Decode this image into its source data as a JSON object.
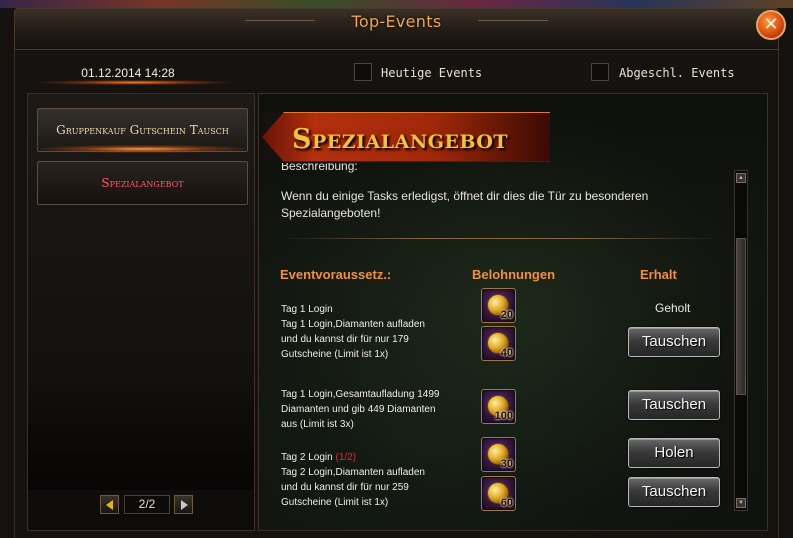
{
  "window": {
    "title": "Top-Events",
    "close_icon": "close-icon"
  },
  "header": {
    "datetime": "01.12.2014 14:28",
    "filters": [
      {
        "label": "Heutige Events",
        "checked": false
      },
      {
        "label": "Abgeschl. Events",
        "checked": false
      }
    ]
  },
  "sidebar": {
    "items": [
      {
        "label": "Gruppenkauf Gutschein Tausch",
        "active": false
      },
      {
        "label": "Spezialangebot",
        "active": true
      }
    ],
    "pager": {
      "current": "2/2"
    }
  },
  "event": {
    "title": "Spezialangebot",
    "description_heading": "Beschreibung:",
    "description": "Wenn du einige Tasks erledigst, öffnet dir dies die Tür zu besonderen Spezialangeboten!",
    "columns": {
      "requirement": "Eventvoraussetz.:",
      "rewards": "Belohnungen",
      "status": "Erhalt"
    },
    "rows": [
      {
        "requirement": "Tag 1 Login",
        "reward_count": "20",
        "status": "Geholt"
      },
      {
        "requirement": "Tag 1 Login,Diamanten aufladen und du kannst dir für nur 179 Gutscheine (Limit ist 1x)",
        "reward_count": "40",
        "button": "Tauschen"
      },
      {
        "requirement": "Tag 1 Login,Gesamtaufladung 1499 Diamanten und gib 449 Diamanten aus (Limit ist 3x)",
        "reward_count": "100",
        "button": "Tauschen"
      },
      {
        "requirement": "Tag 2 Login",
        "progress": "(1/2)",
        "reward_count": "30",
        "button": "Holen"
      },
      {
        "requirement": "Tag 2 Login,Diamanten aufladen und du kannst dir für nur 259 Gutscheine (Limit ist 1x)",
        "reward_count": "60",
        "button": "Tauschen"
      }
    ],
    "reward_icon": "gold-coin-icon"
  },
  "colors": {
    "accent": "#f09040",
    "title": "#f1a64a",
    "banner_text": "#f4c040",
    "active_item": "#ff5a6a",
    "progress": "#e8282a"
  }
}
